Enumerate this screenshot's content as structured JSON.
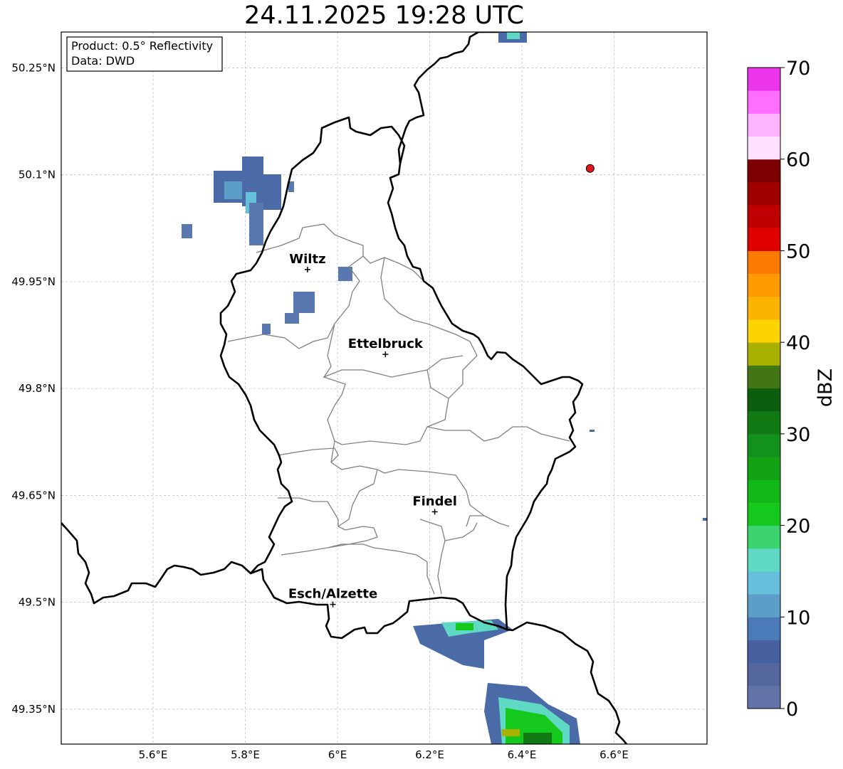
{
  "title": "24.11.2025 19:28 UTC",
  "info_box": {
    "product": "Product: 0.5° Reflectivity",
    "source": "Data: DWD"
  },
  "longitude_ticks": [
    "5.6°E",
    "5.8°E",
    "6°E",
    "6.2°E",
    "6.4°E",
    "6.6°E"
  ],
  "latitude_ticks": [
    "50.25°N",
    "50.1°N",
    "49.95°N",
    "49.8°N",
    "49.65°N",
    "49.5°N",
    "49.35°N"
  ],
  "cities": [
    {
      "name": "Wiltz",
      "lon": 5.935,
      "lat": 49.967
    },
    {
      "name": "Ettelbruck",
      "lon": 6.104,
      "lat": 49.848
    },
    {
      "name": "Findel",
      "lon": 6.211,
      "lat": 49.627
    },
    {
      "name": "Esch/Alzette",
      "lon": 5.99,
      "lat": 49.497
    }
  ],
  "radar_site": {
    "lon": 6.548,
    "lat": 50.109,
    "color": "#e8141c"
  },
  "colorbar": {
    "label": "dBZ",
    "min": 0,
    "max": 70,
    "ticks": [
      "0",
      "10",
      "20",
      "30",
      "40",
      "50",
      "60",
      "70"
    ],
    "colors": [
      "#6274a8",
      "#54689f",
      "#4660a0",
      "#4a7ab8",
      "#5b9ec8",
      "#66c0dc",
      "#5fd9c4",
      "#3cd46e",
      "#14c81c",
      "#12b818",
      "#12a214",
      "#12921c",
      "#127a14",
      "#0b5e0d",
      "#427614",
      "#aab000",
      "#fcd400",
      "#fcb400",
      "#fc9a00",
      "#fc7a00",
      "#e00000",
      "#c00000",
      "#a00000",
      "#7c0000",
      "#ffe0ff",
      "#ffb4ff",
      "#ff6eff",
      "#ec34ec"
    ]
  },
  "colors": {
    "border": "#000000",
    "canton_border": "#808080",
    "grid": "#b8b8b8"
  }
}
